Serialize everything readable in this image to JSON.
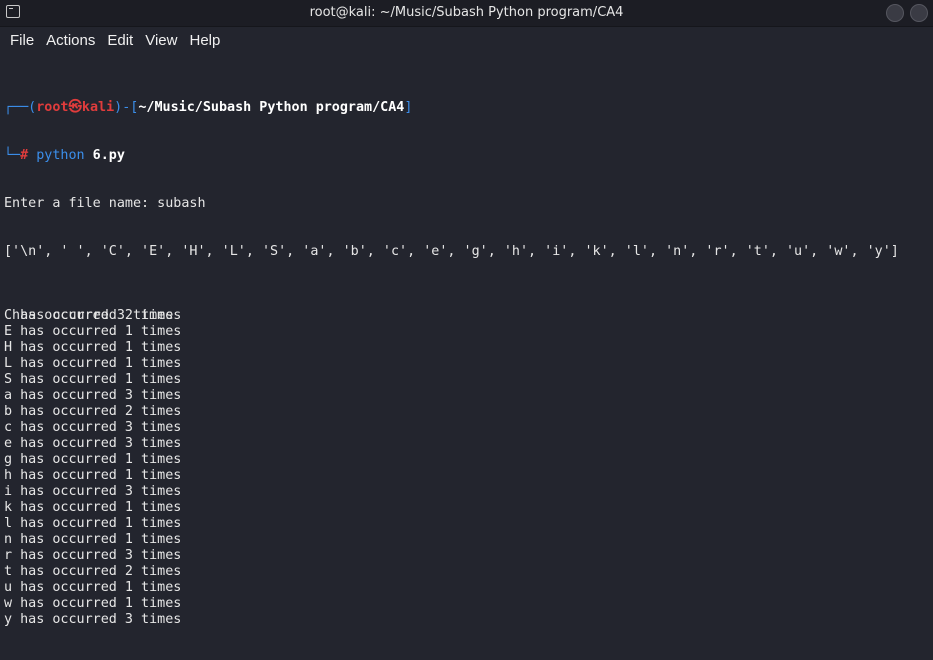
{
  "window": {
    "title": "root@kali: ~/Music/Subash Python program/CA4"
  },
  "menu": [
    "File",
    "Actions",
    "Edit",
    "View",
    "Help"
  ],
  "prompt": {
    "corner_top": "┌──(",
    "user": "root㉿kali",
    "mid": ")-[",
    "path": "~/Music/Subash Python program/CA4",
    "end": "]",
    "corner_bottom": "└─",
    "hash": "# ",
    "command": "python",
    "arg": " 6.py"
  },
  "output": {
    "input_line": "Enter a file name: subash",
    "list_line": "['\\n', ' ', 'C', 'E', 'H', 'L', 'S', 'a', 'b', 'c', 'e', 'g', 'h', 'i', 'k', 'l', 'n', 'r', 't', 'u', 'w', 'y']",
    "blank": "",
    "counts": [
      "\n has occurred 3 times",
      "C has occurred 2 times",
      "E has occurred 1 times",
      "H has occurred 1 times",
      "L has occurred 1 times",
      "S has occurred 1 times",
      "a has occurred 3 times",
      "b has occurred 2 times",
      "c has occurred 3 times",
      "e has occurred 3 times",
      "g has occurred 1 times",
      "h has occurred 1 times",
      "i has occurred 3 times",
      "k has occurred 1 times",
      "l has occurred 1 times",
      "n has occurred 1 times",
      "r has occurred 3 times",
      "t has occurred 2 times",
      "u has occurred 1 times",
      "w has occurred 1 times",
      "y has occurred 3 times"
    ]
  }
}
